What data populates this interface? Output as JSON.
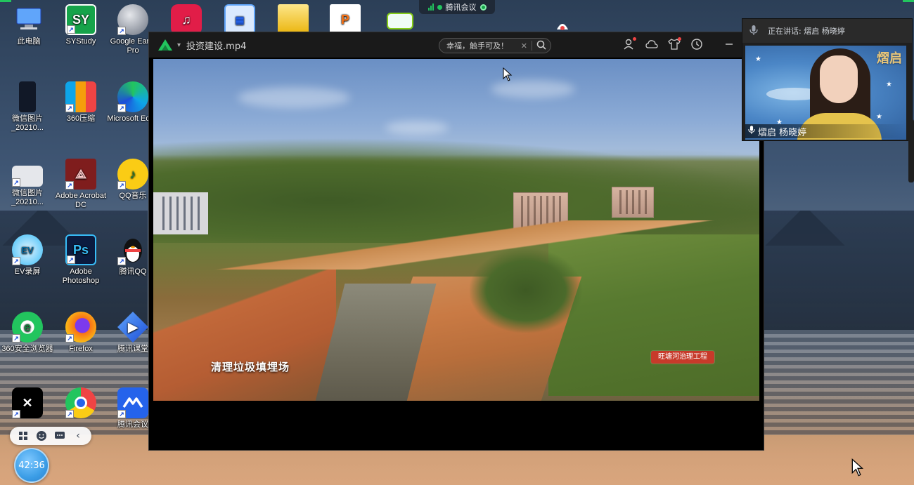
{
  "meeting_bar": {
    "title": "腾讯会议"
  },
  "desktop_icons": [
    {
      "label": "此电脑",
      "icon": "computer-icon",
      "color": "#3b82f6"
    },
    {
      "label": "SYStudy",
      "icon": "systudy-icon",
      "color": "#16a34a"
    },
    {
      "label": "Google Earth Pro",
      "icon": "google-earth-icon",
      "color": "#9ca3af"
    },
    {
      "label": "网易云音乐",
      "icon": "netease-music-icon",
      "color": "#e11d48"
    },
    {
      "label": "",
      "icon": "control-panel-icon",
      "color": "#60a5fa"
    },
    {
      "label": "",
      "icon": "folder-icon",
      "color": "#eab308"
    },
    {
      "label": "",
      "icon": "wps-ppt-icon",
      "color": "#f97316"
    },
    {
      "label": "",
      "icon": "photo-app-icon",
      "color": "#84cc16"
    },
    {
      "label": "微信图片_20210...",
      "icon": "image-file-icon",
      "color": "#111827"
    },
    {
      "label": "360压缩",
      "icon": "zip-archive-icon",
      "color": "#0ea5e9"
    },
    {
      "label": "Microsoft Edge",
      "icon": "edge-icon",
      "color": "#0ea5e9"
    },
    {
      "label": "微信图片_20210...",
      "icon": "image-file-icon",
      "color": "#e5e7eb"
    },
    {
      "label": "Adobe Acrobat DC",
      "icon": "acrobat-icon",
      "color": "#7f1d1d"
    },
    {
      "label": "QQ音乐",
      "icon": "qq-music-icon",
      "color": "#facc15"
    },
    {
      "label": "EV录屏",
      "icon": "ev-recorder-icon",
      "color": "#38bdf8"
    },
    {
      "label": "Adobe Photoshop",
      "icon": "photoshop-icon",
      "color": "#1e3a8a"
    },
    {
      "label": "腾讯QQ",
      "icon": "qq-penguin-icon",
      "color": "#111827"
    },
    {
      "label": "360安全浏览器",
      "icon": "360-browser-icon",
      "color": "#22c55e"
    },
    {
      "label": "Firefox",
      "icon": "firefox-icon",
      "color": "#f97316"
    },
    {
      "label": "腾讯课堂",
      "icon": "tencent-classroom-icon",
      "color": "#2563eb"
    },
    {
      "label": "剪映",
      "icon": "capcut-icon",
      "color": "#111827"
    },
    {
      "label": "Google Chrome",
      "icon": "chrome-icon",
      "color": "#ef4444"
    },
    {
      "label": "腾讯会议",
      "icon": "tencent-meeting-icon",
      "color": "#2563eb"
    }
  ],
  "player": {
    "file_title": "投资建设.mp4",
    "search_text": "幸福，触手可及！",
    "video": {
      "caption": "清理垃圾填埋场",
      "tag": "旺塘河治理工程"
    }
  },
  "speaker": {
    "status_label": "正在讲话: 熠启 杨晓婷",
    "name_label": "熠启 杨晓婷",
    "sticker": "熠启"
  },
  "timer": {
    "value": "42:36"
  }
}
